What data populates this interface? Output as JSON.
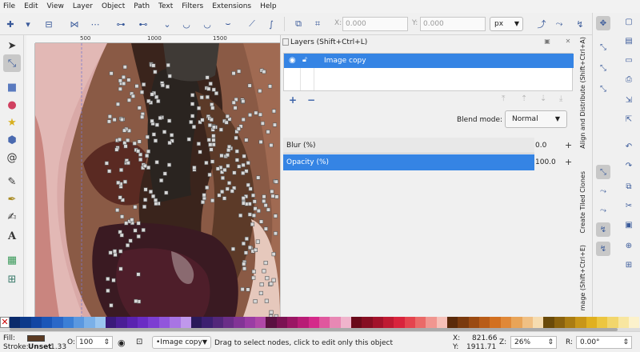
{
  "menu": [
    "File",
    "Edit",
    "View",
    "Layer",
    "Object",
    "Path",
    "Text",
    "Filters",
    "Extensions",
    "Help"
  ],
  "toolctrl": {
    "x_label": "X:",
    "x_value": "0.000",
    "y_label": "Y:",
    "y_value": "0.000",
    "units": "px",
    "icons": [
      "insert-node-icon",
      "delete-node-icon",
      "join-nodes-icon",
      "break-path-icon",
      "join-segment-icon",
      "delete-segment-icon",
      "node-cusp-icon",
      "node-smooth-icon",
      "node-symmetric-icon",
      "node-auto-icon",
      "segment-line-icon",
      "segment-curve-icon",
      "object-to-path-icon",
      "stroke-to-path-icon"
    ]
  },
  "ruler": {
    "h_labels": [
      "500",
      "1000",
      "1500"
    ]
  },
  "dock": {
    "title": "Layers (Shift+Ctrl+L)",
    "layers": [
      {
        "name": "Image copy",
        "selected": true
      }
    ],
    "blend_label": "Blend mode:",
    "blend_value": "Normal",
    "blur_label": "Blur (%)",
    "blur_value": "0.0",
    "opacity_label": "Opacity (%)",
    "opacity_value": "100.0"
  },
  "vtabs": {
    "align": "Align and Distribute (Shift+Ctrl+A)",
    "clones": "Create Tiled Clones",
    "image": "mage (Shift+Ctrl+E)"
  },
  "tools": [
    "selector-tool-icon",
    "node-tool-icon",
    "rect-tool-icon",
    "ellipse-tool-icon",
    "star-tool-icon",
    "box3d-tool-icon",
    "spiral-tool-icon",
    "pencil-tool-icon",
    "pen-tool-icon",
    "calligraphy-tool-icon",
    "text-tool-icon",
    "gradient-tool-icon",
    "mesh-tool-icon"
  ],
  "palette_colors": [
    "#0a2a6b",
    "#0d3a8a",
    "#1346a3",
    "#1a56b8",
    "#2a68c8",
    "#3b7fd6",
    "#5a98e0",
    "#7ab0e8",
    "#9ac6f0",
    "#3a1a7a",
    "#4a1e96",
    "#5a22b0",
    "#6a2cc4",
    "#7c3ed2",
    "#9156dc",
    "#a874e4",
    "#c098ec",
    "#2a1a5a",
    "#3c2070",
    "#52277a",
    "#6a2e88",
    "#823496",
    "#9a3ca4",
    "#b048a8",
    "#5a1040",
    "#7a1252",
    "#9a1664",
    "#b81c76",
    "#d42a8a",
    "#e0589e",
    "#e888b4",
    "#f0b4cc",
    "#6a0a1a",
    "#860e22",
    "#a2122a",
    "#be1a32",
    "#d8243c",
    "#e4444e",
    "#ea6a68",
    "#f09690",
    "#f6c0b8",
    "#5a2a0a",
    "#7a3a0e",
    "#9a4a12",
    "#b85c18",
    "#d27020",
    "#e08838",
    "#e8a458",
    "#f0c084",
    "#f6dcb0",
    "#6a4a0a",
    "#8a620e",
    "#aa7c12",
    "#c89618",
    "#e0b020",
    "#ecc640",
    "#f2d66c",
    "#f8e6a0",
    "#fcf2cc"
  ],
  "status": {
    "fill_label": "Fill:",
    "stroke_label": "Stroke:",
    "stroke_value": "Unset",
    "stroke_width": "1.33",
    "opacity_label": "O:",
    "opacity_value": "100",
    "layer_value": "•Image copy",
    "message": "Drag to select nodes, click to edit only this object",
    "x_label": "X:",
    "x_value": "821.66",
    "y_label": "Y:",
    "y_value": "1911.71",
    "z_label": "Z:",
    "zoom_value": "26%",
    "r_label": "R:",
    "rotation_value": "0.00°"
  }
}
